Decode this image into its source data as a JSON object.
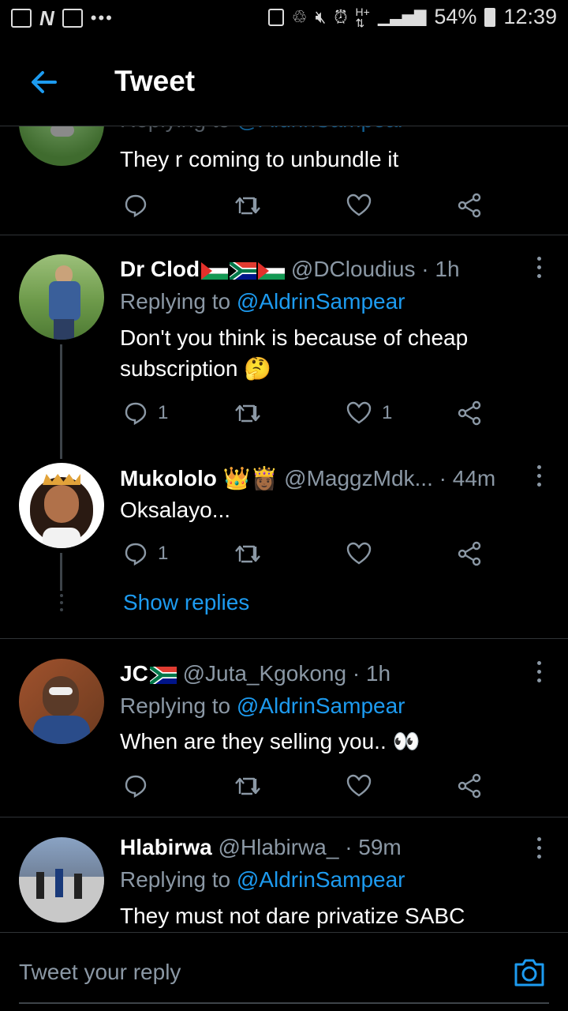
{
  "status_bar": {
    "battery": "54%",
    "time": "12:39"
  },
  "header": {
    "title": "Tweet"
  },
  "tweets": [
    {
      "replying_prefix": "Replying to",
      "replying_to": "@AldrinSampear",
      "text": "They r coming to unbundle it",
      "reply_count": "",
      "like_count": ""
    },
    {
      "name": "Dr Clod",
      "handle": "@DCloudius",
      "time": "· 1h",
      "replying_prefix": "Replying to",
      "replying_to": "@AldrinSampear",
      "text": "Don't you think is because of cheap subscription 🤔",
      "reply_count": "1",
      "like_count": "1"
    },
    {
      "name": "Mukololo 👑👸🏾",
      "handle": "@MaggzMdk...",
      "time": "· 44m",
      "text": "Oksalayo...",
      "reply_count": "1",
      "like_count": "",
      "show_replies": "Show replies"
    },
    {
      "name": "JC",
      "handle": "@Juta_Kgokong",
      "time": "· 1h",
      "replying_prefix": "Replying to",
      "replying_to": "@AldrinSampear",
      "text": "When are they selling you.. 👀",
      "reply_count": "",
      "like_count": ""
    },
    {
      "name": "Hlabirwa",
      "handle": "@Hlabirwa_",
      "time": "· 59m",
      "replying_prefix": "Replying to",
      "replying_to": "@AldrinSampear",
      "text": "They must not dare privatize SABC"
    }
  ],
  "compose": {
    "placeholder": "Tweet your reply"
  },
  "colors": {
    "accent": "#1d9bf0",
    "muted": "#8b98a5",
    "background": "#000000"
  }
}
